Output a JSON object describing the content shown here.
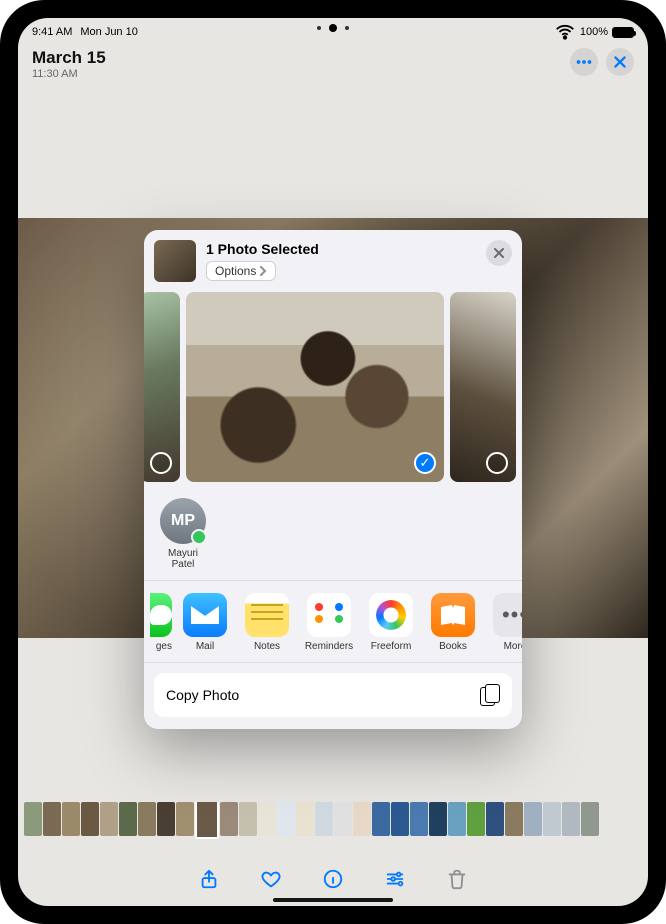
{
  "status": {
    "time": "9:41 AM",
    "date": "Mon Jun 10",
    "battery": "100%"
  },
  "header": {
    "title": "March 15",
    "subtitle": "11:30 AM"
  },
  "sheet": {
    "title": "1 Photo Selected",
    "options_label": "Options",
    "contacts": [
      {
        "initials": "MP",
        "name": "Mayuri Patel"
      }
    ],
    "apps_partial_left": {
      "label": "ges"
    },
    "apps": [
      {
        "label": "Mail"
      },
      {
        "label": "Notes"
      },
      {
        "label": "Reminders"
      },
      {
        "label": "Freeform"
      },
      {
        "label": "Books"
      },
      {
        "label": "More"
      }
    ],
    "actions": {
      "copy": "Copy Photo"
    }
  }
}
